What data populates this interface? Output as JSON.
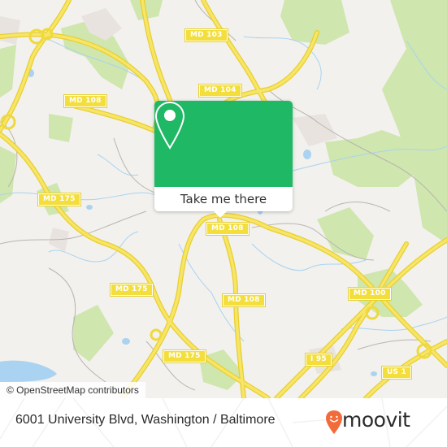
{
  "map": {
    "road_labels": [
      {
        "id": "md103",
        "text": "MD 103"
      },
      {
        "id": "md104",
        "text": "MD 104"
      },
      {
        "id": "md108-nw",
        "text": "MD 108"
      },
      {
        "id": "md175-w",
        "text": "MD 175"
      },
      {
        "id": "md108-center",
        "text": "MD 108"
      },
      {
        "id": "md175-sw",
        "text": "MD 175"
      },
      {
        "id": "md108-south",
        "text": "MD 108"
      },
      {
        "id": "md100",
        "text": "MD 100"
      },
      {
        "id": "md175-s",
        "text": "MD 175"
      },
      {
        "id": "i95",
        "text": "I 95"
      },
      {
        "id": "us1",
        "text": "US 1"
      }
    ],
    "attribution": "© OpenStreetMap contributors",
    "colors": {
      "land": "#f2f1ed",
      "park": "#cfe6ae",
      "water": "#a9d3f0",
      "road_major": "#f3de3c",
      "road_minor": "#b9b5ae"
    }
  },
  "popup": {
    "pin_icon": "location-pin-icon",
    "button_label": "Take me there",
    "accent": "#1fb865"
  },
  "footer": {
    "address": "6001 University Blvd, Washington / Baltimore",
    "brand": "moovit",
    "brand_color": "#f26b3a"
  }
}
